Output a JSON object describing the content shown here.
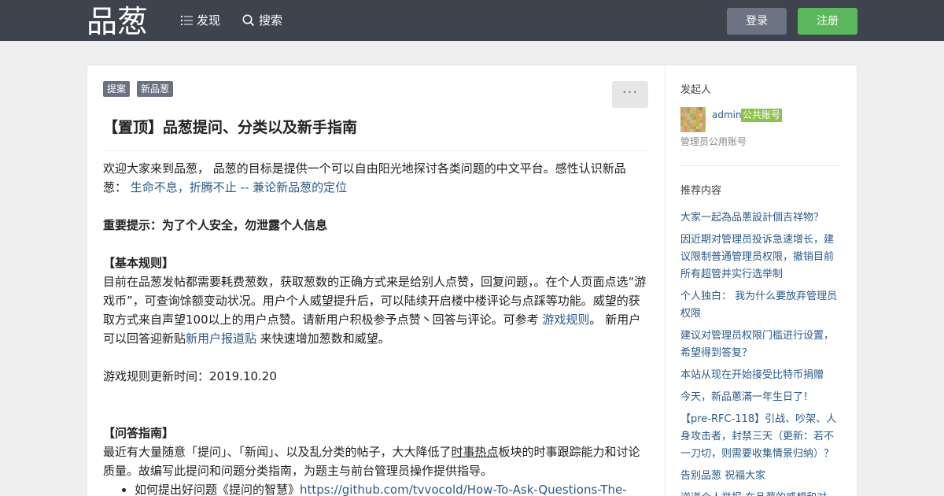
{
  "header": {
    "logo_text": "品葱",
    "nav": [
      {
        "label": "发现",
        "icon": "list-icon"
      },
      {
        "label": "搜索",
        "icon": "search-icon"
      }
    ],
    "login_label": "登录",
    "register_label": "注册",
    "bg_color": "#3e434e"
  },
  "post": {
    "tags": [
      "提案",
      "新品葱"
    ],
    "more_label": "···",
    "title": "【置顶】品葱提问、分类以及新手指南",
    "intro_a": "欢迎大家来到品葱， 品葱的目标是提供一个可以自由阳光地探讨各类问题的中文平台。感性认识新品葱： ",
    "intro_link": "生命不息，折腾不止 -- 兼论新品葱的定位",
    "warning": "重要提示：为了个人安全，勿泄露个人信息",
    "rules_heading": "【基本规则】",
    "rules_a": "目前在品葱发帖都需要耗费葱数，获取葱数的正确方式来是给别人点赞，回复问题，。在个人页面点选“游戏币”，可查询馀额变动状况。用户个人威望提升后，可以陆续开启楼中楼评论与点踩等功能。威望的获取方式来自声望100以上的用户点赞。请新用户积极参予点赞丶回答与评论。可参考 ",
    "rules_link1": "游戏规则",
    "rules_b": "。 新用户可以回答迎新贴",
    "rules_link2": "新用户报道贴",
    "rules_c": " 来快速增加葱数和威望。",
    "update_time": "游戏规则更新时间：2019.10.20",
    "qa_heading": "【问答指南】",
    "qa_a": "最近有大量随意「提问」、「新闻」、以及乱分类的帖子，大大降低了",
    "qa_link": "时事热点",
    "qa_b": "板块的时事跟踪能力和讨论质量。故编写此提问和问题分类指南，为题主与前台管理员操作提供指导。",
    "qa_item_text": "如何提出好问题《提问的智慧》",
    "qa_item_link": "https://github.com/tvvocold/How-To-Ask-Questions-The-"
  },
  "sidebar": {
    "initiator_heading": "发起人",
    "author_name": "admin",
    "author_badge": "公共账号",
    "author_desc": "管理员公用账号",
    "recommend_heading": "推荐内容",
    "recommended": [
      "大家一起為品蔥設計個吉祥物？",
      "因近期对管理员投诉急速增长，建议限制普通管理员权限，撤销目前所有超管并实行选举制",
      "个人独白： 我为什么要放弃管理员权限",
      "建议对管理员权限门槛进行设置，希望得到答复？",
      "本站从现在开始接受比特币捐赠",
      "今天，新品蔥滿一年生日了！",
      "【pre-RFC-118】引战、吵架、人身攻击者，封禁三天（更新：若不一刀切，则需要收集情景归纳）？",
      "告别品葱 祝福大家",
      "逆道个人举报 在品葱的感想和对"
    ]
  }
}
